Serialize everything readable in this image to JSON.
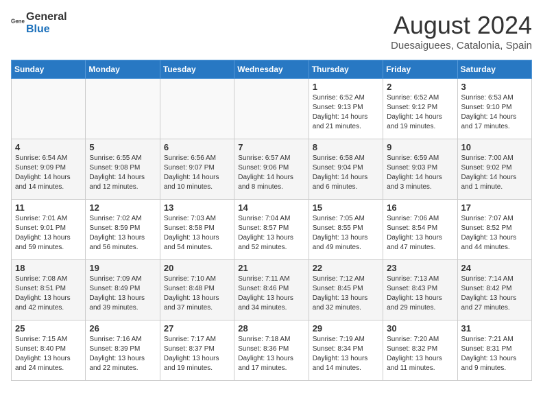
{
  "header": {
    "logo_general": "General",
    "logo_blue": "Blue",
    "month_year": "August 2024",
    "location": "Duesaiguees, Catalonia, Spain"
  },
  "weekdays": [
    "Sunday",
    "Monday",
    "Tuesday",
    "Wednesday",
    "Thursday",
    "Friday",
    "Saturday"
  ],
  "weeks": [
    [
      {
        "day": "",
        "info": ""
      },
      {
        "day": "",
        "info": ""
      },
      {
        "day": "",
        "info": ""
      },
      {
        "day": "",
        "info": ""
      },
      {
        "day": "1",
        "info": "Sunrise: 6:52 AM\nSunset: 9:13 PM\nDaylight: 14 hours\nand 21 minutes."
      },
      {
        "day": "2",
        "info": "Sunrise: 6:52 AM\nSunset: 9:12 PM\nDaylight: 14 hours\nand 19 minutes."
      },
      {
        "day": "3",
        "info": "Sunrise: 6:53 AM\nSunset: 9:10 PM\nDaylight: 14 hours\nand 17 minutes."
      }
    ],
    [
      {
        "day": "4",
        "info": "Sunrise: 6:54 AM\nSunset: 9:09 PM\nDaylight: 14 hours\nand 14 minutes."
      },
      {
        "day": "5",
        "info": "Sunrise: 6:55 AM\nSunset: 9:08 PM\nDaylight: 14 hours\nand 12 minutes."
      },
      {
        "day": "6",
        "info": "Sunrise: 6:56 AM\nSunset: 9:07 PM\nDaylight: 14 hours\nand 10 minutes."
      },
      {
        "day": "7",
        "info": "Sunrise: 6:57 AM\nSunset: 9:06 PM\nDaylight: 14 hours\nand 8 minutes."
      },
      {
        "day": "8",
        "info": "Sunrise: 6:58 AM\nSunset: 9:04 PM\nDaylight: 14 hours\nand 6 minutes."
      },
      {
        "day": "9",
        "info": "Sunrise: 6:59 AM\nSunset: 9:03 PM\nDaylight: 14 hours\nand 3 minutes."
      },
      {
        "day": "10",
        "info": "Sunrise: 7:00 AM\nSunset: 9:02 PM\nDaylight: 14 hours\nand 1 minute."
      }
    ],
    [
      {
        "day": "11",
        "info": "Sunrise: 7:01 AM\nSunset: 9:01 PM\nDaylight: 13 hours\nand 59 minutes."
      },
      {
        "day": "12",
        "info": "Sunrise: 7:02 AM\nSunset: 8:59 PM\nDaylight: 13 hours\nand 56 minutes."
      },
      {
        "day": "13",
        "info": "Sunrise: 7:03 AM\nSunset: 8:58 PM\nDaylight: 13 hours\nand 54 minutes."
      },
      {
        "day": "14",
        "info": "Sunrise: 7:04 AM\nSunset: 8:57 PM\nDaylight: 13 hours\nand 52 minutes."
      },
      {
        "day": "15",
        "info": "Sunrise: 7:05 AM\nSunset: 8:55 PM\nDaylight: 13 hours\nand 49 minutes."
      },
      {
        "day": "16",
        "info": "Sunrise: 7:06 AM\nSunset: 8:54 PM\nDaylight: 13 hours\nand 47 minutes."
      },
      {
        "day": "17",
        "info": "Sunrise: 7:07 AM\nSunset: 8:52 PM\nDaylight: 13 hours\nand 44 minutes."
      }
    ],
    [
      {
        "day": "18",
        "info": "Sunrise: 7:08 AM\nSunset: 8:51 PM\nDaylight: 13 hours\nand 42 minutes."
      },
      {
        "day": "19",
        "info": "Sunrise: 7:09 AM\nSunset: 8:49 PM\nDaylight: 13 hours\nand 39 minutes."
      },
      {
        "day": "20",
        "info": "Sunrise: 7:10 AM\nSunset: 8:48 PM\nDaylight: 13 hours\nand 37 minutes."
      },
      {
        "day": "21",
        "info": "Sunrise: 7:11 AM\nSunset: 8:46 PM\nDaylight: 13 hours\nand 34 minutes."
      },
      {
        "day": "22",
        "info": "Sunrise: 7:12 AM\nSunset: 8:45 PM\nDaylight: 13 hours\nand 32 minutes."
      },
      {
        "day": "23",
        "info": "Sunrise: 7:13 AM\nSunset: 8:43 PM\nDaylight: 13 hours\nand 29 minutes."
      },
      {
        "day": "24",
        "info": "Sunrise: 7:14 AM\nSunset: 8:42 PM\nDaylight: 13 hours\nand 27 minutes."
      }
    ],
    [
      {
        "day": "25",
        "info": "Sunrise: 7:15 AM\nSunset: 8:40 PM\nDaylight: 13 hours\nand 24 minutes."
      },
      {
        "day": "26",
        "info": "Sunrise: 7:16 AM\nSunset: 8:39 PM\nDaylight: 13 hours\nand 22 minutes."
      },
      {
        "day": "27",
        "info": "Sunrise: 7:17 AM\nSunset: 8:37 PM\nDaylight: 13 hours\nand 19 minutes."
      },
      {
        "day": "28",
        "info": "Sunrise: 7:18 AM\nSunset: 8:36 PM\nDaylight: 13 hours\nand 17 minutes."
      },
      {
        "day": "29",
        "info": "Sunrise: 7:19 AM\nSunset: 8:34 PM\nDaylight: 13 hours\nand 14 minutes."
      },
      {
        "day": "30",
        "info": "Sunrise: 7:20 AM\nSunset: 8:32 PM\nDaylight: 13 hours\nand 11 minutes."
      },
      {
        "day": "31",
        "info": "Sunrise: 7:21 AM\nSunset: 8:31 PM\nDaylight: 13 hours\nand 9 minutes."
      }
    ]
  ]
}
